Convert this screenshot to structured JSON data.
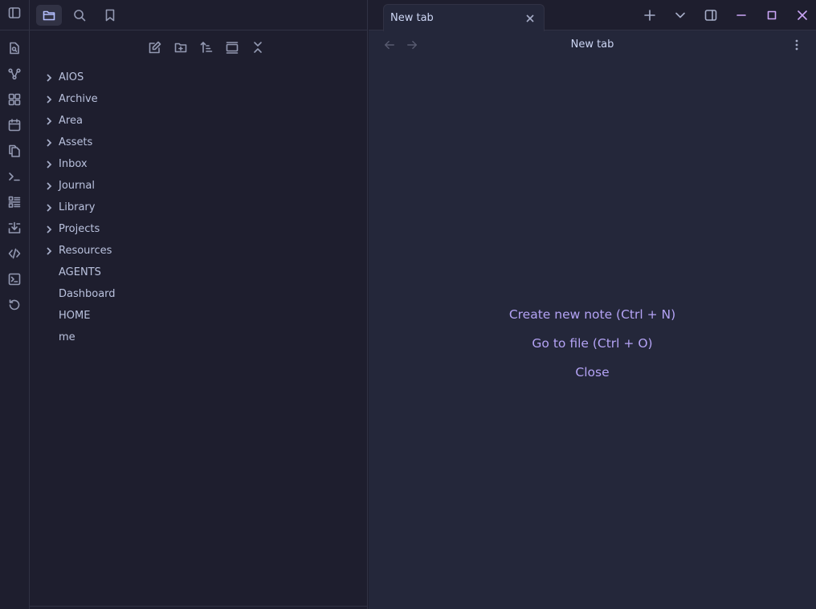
{
  "ribbon": {
    "toggle_icon": "sidebar-left-icon",
    "items": [
      {
        "icon": "file-search-icon"
      },
      {
        "icon": "graph-view-icon"
      },
      {
        "icon": "canvas-icon"
      },
      {
        "icon": "calendar-icon"
      },
      {
        "icon": "copy-files-icon"
      },
      {
        "icon": "terminal-prompt-icon"
      },
      {
        "icon": "list-view-icon"
      },
      {
        "icon": "import-icon"
      },
      {
        "icon": "code-icon"
      },
      {
        "icon": "console-icon"
      },
      {
        "icon": "history-icon"
      }
    ]
  },
  "sidebar": {
    "tabs": [
      {
        "icon": "folder-icon",
        "active": true
      },
      {
        "icon": "search-icon",
        "active": false
      },
      {
        "icon": "bookmark-icon",
        "active": false
      }
    ],
    "actions": [
      {
        "icon": "new-note-icon"
      },
      {
        "icon": "new-folder-icon"
      },
      {
        "icon": "sort-icon"
      },
      {
        "icon": "auto-reveal-icon"
      },
      {
        "icon": "collapse-all-icon"
      }
    ],
    "folders": [
      "AIOS",
      "Archive",
      "Area",
      "Assets",
      "Inbox",
      "Journal",
      "Library",
      "Projects",
      "Resources"
    ],
    "files": [
      "AGENTS",
      "Dashboard",
      "HOME",
      "me"
    ]
  },
  "tabbar": {
    "tab_label": "New tab"
  },
  "view": {
    "title": "New tab",
    "actions": {
      "create": "Create new note (Ctrl + N)",
      "goto": "Go to file (Ctrl + O)",
      "close": "Close"
    }
  },
  "colors": {
    "background": "#1e1e2e",
    "main_background": "#24273a",
    "accent": "#b4a3f5",
    "border": "#313244"
  }
}
